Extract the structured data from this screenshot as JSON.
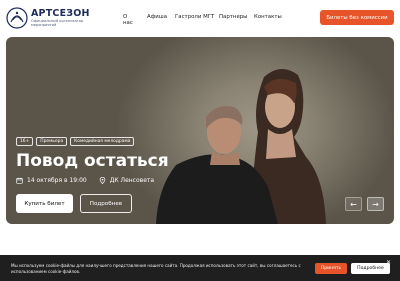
{
  "header": {
    "logo_title": "АРТСЕЗОН",
    "logo_subtitle": "Официальный организатор мероприятий",
    "nav": [
      "О нас",
      "Афиша",
      "Гастроли МГТ",
      "Партнеры",
      "Контакты"
    ],
    "cta_label": "Билеты без комиссии"
  },
  "hero": {
    "tags": [
      "16+",
      "Премьера",
      "Комедийная мелодрама"
    ],
    "title": "Повод остаться",
    "date": "14 октября в 19:00",
    "venue": "ДК Ленсовета",
    "buy_label": "Купить билет",
    "more_label": "Подробнее",
    "prev_icon": "arrow-left-icon",
    "next_icon": "arrow-right-icon"
  },
  "cookie": {
    "text": "Мы используем cookie-файлы для наилучшего представления нашего сайта. Продолжая использовать этот сайт, вы соглашаетесь с использованием cookie-файлов.",
    "accept_label": "Принять",
    "details_label": "Подробнее"
  },
  "colors": {
    "accent": "#e8542a",
    "brand": "#1e2a5a",
    "cookie_bg": "#1f1f1f"
  }
}
